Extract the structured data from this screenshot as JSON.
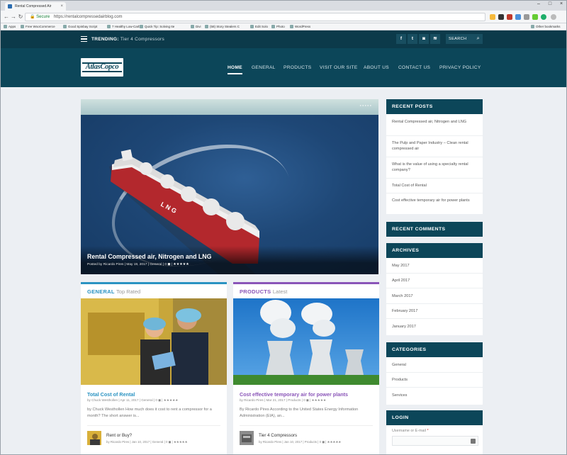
{
  "browser": {
    "tab_title": "Rental Compressed Air ×",
    "tab_title_short": "Rental Compressed Air",
    "address_secure": "Secure",
    "address_url": "https://rentalcompressedairblog.com",
    "bookmarks": [
      "Apps",
      "Free WooCommerce",
      "Good Spinbay Script",
      "7 Healthy Low-Carb",
      "Quick Tip: Solving Ite",
      "Divi",
      "(58) Story Stealers C",
      "Edit Solo",
      "Photo",
      "WordPress"
    ],
    "other_bookmarks": "Other bookmarks"
  },
  "topbar": {
    "trending_label": "TRENDING:",
    "trending_text": "Tier 4 Compressors",
    "social": [
      "f",
      "t",
      "◙",
      "≋"
    ],
    "search_label": "SEARCH"
  },
  "header": {
    "logo_text": "AtlasCopco",
    "nav": [
      "HOME",
      "GENERAL",
      "PRODUCTS",
      "VISIT OUR SITE",
      "ABOUT US",
      "CONTACT US",
      "PRIVACY POLICY"
    ]
  },
  "hero": {
    "title": "Rental Compressed air, Nitrogen and LNG",
    "meta": "Posted by Ricardo Pires | May 19, 2017 | General | 0 ◼ |",
    "stars": "★★★★★"
  },
  "columns": [
    {
      "heading": "GENERAL",
      "subheading": "Top Rated",
      "accent": "#2a93c2",
      "post_title": "Total Cost of Rental",
      "post_meta": "by Chuck Westhollen | Apr 11, 2017 | General | 0 ◼ | ★★★★★",
      "excerpt": "by Chuck Westhollen How much does it cost to rent a compressor for a month? The short answer is...",
      "mini_title": "Rent or Buy?",
      "mini_meta": "by Ricardo Pires | Jan 10, 2017 | General | 0 ◼ | ★★★★★"
    },
    {
      "heading": "PRODUCTS",
      "subheading": "Latest",
      "accent": "#8a55b8",
      "post_title": "Cost effective temporary air for power plants",
      "post_meta": "by Ricardo Pires | Mar 21, 2017 | Products | 0 ◼ | ★★★★★",
      "excerpt": "By Ricardo Pires According to the United States Energy Information Administration (EIA), an...",
      "mini_title": "Tier 4 Compressors",
      "mini_meta": "by Ricardo Pires | Jan 10, 2017 | Products | 0 ◼ | ★★★★★"
    }
  ],
  "sidebar": {
    "recent_posts": {
      "title": "RECENT POSTS",
      "items": [
        "Rental Compressed air, Nitrogen and LNG",
        "The Pulp and Paper Industry – Clean rental compressed air",
        "What is the value of using a specialty rental company?",
        "Total Cost of Rental",
        "Cost effective temporary air for power plants"
      ]
    },
    "recent_comments": {
      "title": "RECENT COMMENTS"
    },
    "archives": {
      "title": "ARCHIVES",
      "items": [
        "May 2017",
        "April 2017",
        "March 2017",
        "February 2017",
        "January 2017"
      ]
    },
    "categories": {
      "title": "CATEGORIES",
      "items": [
        "General",
        "Products",
        "Services"
      ]
    },
    "login": {
      "title": "LOGIN",
      "username_label": "Username or E-mail",
      "required_mark": "*"
    }
  },
  "colors": {
    "topbar": "#0c3a4a",
    "navbar": "#0c4659",
    "general_accent": "#2a93c2",
    "products_accent": "#8a55b8"
  }
}
